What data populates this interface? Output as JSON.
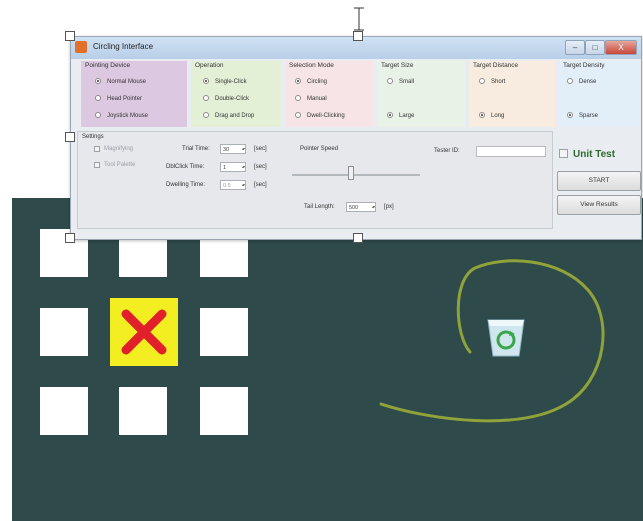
{
  "window": {
    "title": "Circling Interface",
    "min": "–",
    "max": "□",
    "close": "X"
  },
  "groups": {
    "pointing": {
      "title": "Pointing Device",
      "color": "#dcc8e0",
      "options": [
        "Normal Mouse",
        "Head Pointer",
        "Joystick Mouse"
      ],
      "selected": 0
    },
    "operation": {
      "title": "Operation",
      "color": "#e3f0d6",
      "options": [
        "Single-Click",
        "Double-Click",
        "Drag and Drop"
      ],
      "selected": 0
    },
    "selection": {
      "title": "Selection Mode",
      "color": "#f6e4e6",
      "options": [
        "Circling",
        "Manual",
        "Dwell-Clicking"
      ],
      "selected": 0
    },
    "size": {
      "title": "Target Size",
      "color": "#e9f2e6",
      "options": [
        "Small",
        "Large"
      ],
      "selected": 1
    },
    "distance": {
      "title": "Target Distance",
      "color": "#f7ecdf",
      "options": [
        "Short",
        "Long"
      ],
      "selected": 1
    },
    "density": {
      "title": "Target Density",
      "color": "#e2eef8",
      "options": [
        "Dense",
        "Sparse"
      ],
      "selected": 1
    }
  },
  "settings": {
    "title": "Settings",
    "magnifying": "Magnifying",
    "tool_palette": "Tool Palette",
    "trial_time_label": "Trial Time:",
    "trial_time_value": "30",
    "trial_time_unit": "[sec]",
    "dbl_click_label": "DblClick Time:",
    "dbl_click_value": "1",
    "dbl_click_unit": "[sec]",
    "dwelling_label": "Dwelling Time:",
    "dwelling_value": "0.5",
    "dwelling_unit": "[sec]",
    "pointer_speed_label": "Pointer Speed",
    "tester_label": "Tester ID:",
    "tester_value": "",
    "tail_label": "Tail Length:",
    "tail_value": "500",
    "tail_unit": "[px]"
  },
  "unit_test_label": "Unit Test",
  "start_label": "START",
  "view_results_label": "View Results",
  "canvas": {
    "background": "#2e4a4a",
    "trail_color": "#8fa33a",
    "target_color": "#f2ee22",
    "x_color": "#e0202a"
  }
}
